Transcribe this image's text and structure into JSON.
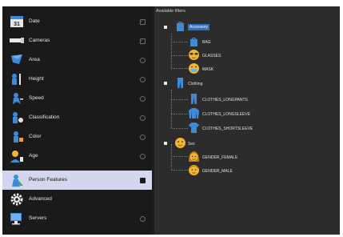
{
  "sidebar": {
    "items": [
      {
        "label": "Date",
        "icon": "calendar-icon",
        "check": "square-checked"
      },
      {
        "label": "Cameras",
        "icon": "camera-icon",
        "check": "square-checked"
      },
      {
        "label": "Area",
        "icon": "area-icon",
        "check": "radio"
      },
      {
        "label": "Height",
        "icon": "height-icon",
        "check": "radio"
      },
      {
        "label": "Speed",
        "icon": "speed-icon",
        "check": "radio"
      },
      {
        "label": "Classification",
        "icon": "classification-icon",
        "check": "radio"
      },
      {
        "label": "Color",
        "icon": "color-icon",
        "check": "radio"
      },
      {
        "label": "Age",
        "icon": "age-icon",
        "check": "radio"
      },
      {
        "label": "Person Features",
        "icon": "person-features-icon",
        "check": "filled"
      },
      {
        "label": "Advanced",
        "icon": "gear-icon",
        "check": "none"
      },
      {
        "label": "Servers",
        "icon": "server-icon",
        "check": "radio"
      }
    ],
    "selected_index": 8
  },
  "tree": {
    "header": "Available filters",
    "groups": [
      {
        "label": "Accessory",
        "icon": "accessory-icon",
        "highlighted": true,
        "children": [
          {
            "label": "BAG",
            "icon": "bag-icon"
          },
          {
            "label": "GLASSES",
            "icon": "glasses-icon"
          },
          {
            "label": "MASK",
            "icon": "mask-icon"
          }
        ]
      },
      {
        "label": "Clothing",
        "icon": "clothing-icon",
        "highlighted": false,
        "children": [
          {
            "label": "CLOTHES_LONGPANTS",
            "icon": "longpants-icon"
          },
          {
            "label": "CLOTHES_LONGSLEEVE",
            "icon": "longsleeve-icon"
          },
          {
            "label": "CLOTHES_SHORTSLEEVE",
            "icon": "shortsleeve-icon"
          }
        ]
      },
      {
        "label": "Sex",
        "icon": "sex-icon",
        "highlighted": false,
        "children": [
          {
            "label": "GENDER_FEMALE",
            "icon": "female-icon"
          },
          {
            "label": "GENDER_MALE",
            "icon": "male-icon"
          }
        ]
      }
    ]
  },
  "colors": {
    "selection": "#d3d6ec",
    "highlight": "#2f6fc4",
    "icon_blue": "#3e8ad8",
    "emoji_yellow": "#f2b632"
  }
}
